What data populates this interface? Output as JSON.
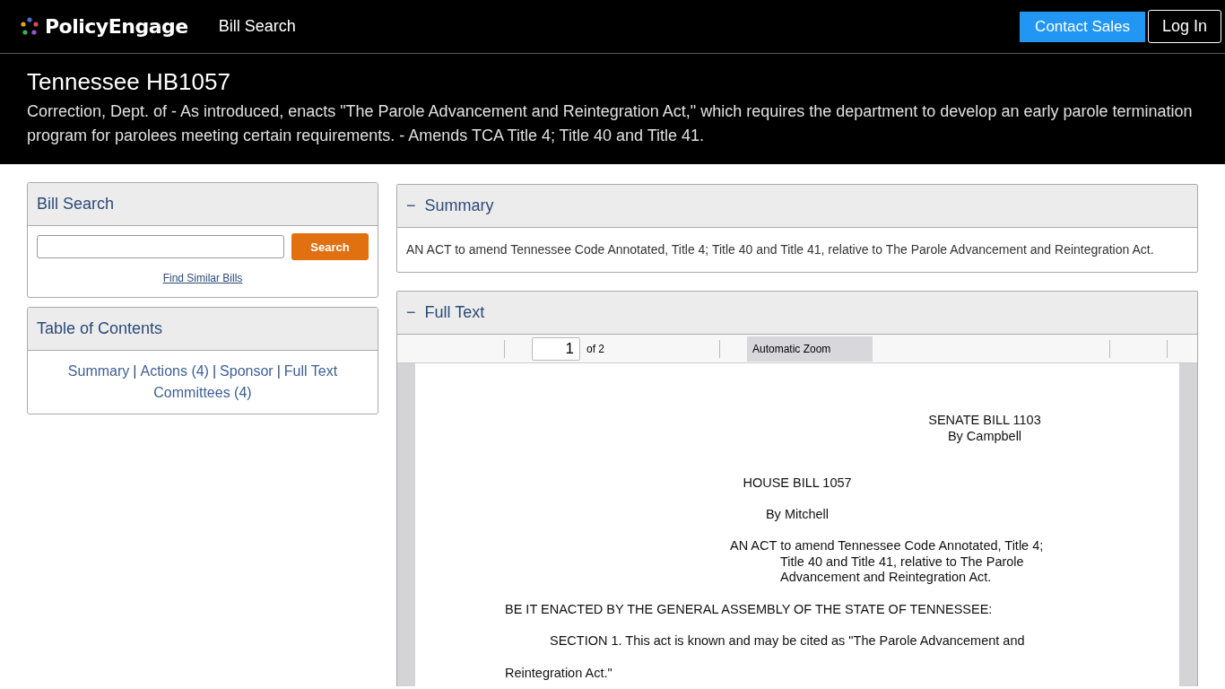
{
  "header": {
    "brand": "PolicyEngage",
    "nav": [
      "Bill Search"
    ],
    "buttons": [
      {
        "kind": "primary",
        "label": "Contact Sales"
      },
      {
        "kind": "outline",
        "label": "Log In"
      }
    ]
  },
  "bill": {
    "title": "Tennessee HB1057",
    "description": "Correction, Dept. of - As introduced, enacts \"The Parole Advancement and Reintegration Act,\" which requires the department to develop an early parole termination program for parolees meeting certain requirements. - Amends TCA Title 4; Title 40 and Title 41."
  },
  "bill_search": {
    "title": "Bill Search",
    "button": "Search",
    "link": "Find Similar Bills"
  },
  "table_of_contents": {
    "title": "Table of Contents",
    "separator": "|",
    "lines": [
      {
        "links": [
          "Summary",
          "Actions (4)",
          "Sponsor",
          "Full Text"
        ]
      },
      {
        "links": [
          "Committees (4)"
        ]
      }
    ]
  },
  "summary": {
    "toggle": "−",
    "title": "Summary",
    "text": "AN ACT to amend Tennessee Code Annotated, Title 4; Title 40 and Title 41, relative to The Parole Advancement and Reintegration Act."
  },
  "full_text": {
    "toggle": "−",
    "title": "Full Text",
    "viewer": {
      "page": "1",
      "page_count": "of 2",
      "zoom": "Automatic Zoom"
    },
    "document": [
      {
        "kind": "right",
        "lines": [
          "SENATE BILL 1103",
          "By Campbell"
        ]
      },
      {
        "kind": "center",
        "lines": [
          "HOUSE BILL 1057"
        ]
      },
      {
        "kind": "center",
        "lines": [
          "By Mitchell"
        ]
      },
      {
        "kind": "act",
        "lines": [
          "AN ACT to amend Tennessee Code Annotated, Title 4;",
          "Title 40 and Title 41, relative to The Parole",
          "Advancement and Reintegration Act."
        ]
      },
      {
        "kind": "plain",
        "lines": [
          "BE IT ENACTED BY THE GENERAL ASSEMBLY OF THE STATE OF TENNESSEE:"
        ]
      },
      {
        "kind": "indent",
        "lines": [
          "SECTION 1.  This act is known and may be cited as \"The Parole Advancement and"
        ]
      },
      {
        "kind": "plain",
        "lines": [
          "Reintegration Act.\""
        ]
      }
    ]
  }
}
